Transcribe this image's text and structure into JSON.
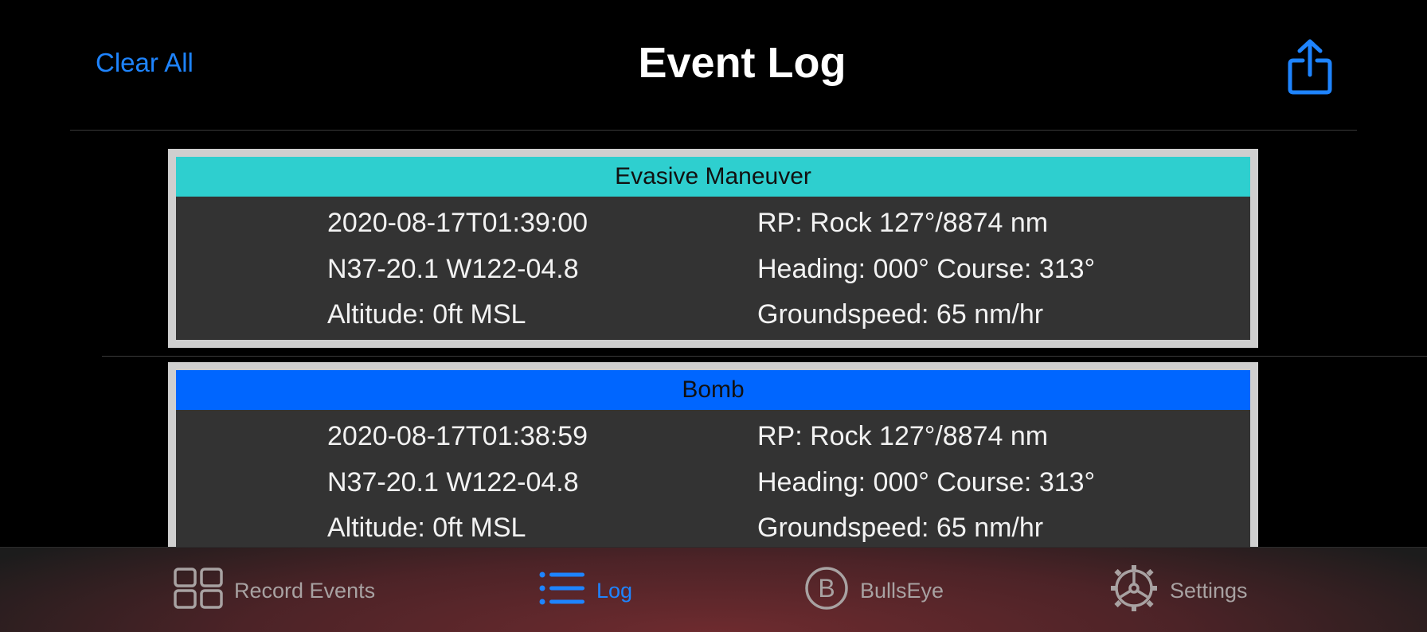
{
  "header": {
    "clear_all_label": "Clear All",
    "title": "Event Log",
    "share_icon": "share-icon"
  },
  "colors": {
    "accent": "#1e84ff",
    "evasive": "#2ecfcf",
    "bomb": "#0066ff"
  },
  "events": [
    {
      "type": "Evasive Maneuver",
      "color": "#2ecfcf",
      "timestamp": "2020-08-17T01:39:00",
      "position": "N37-20.1 W122-04.8",
      "altitude": "Altitude: 0ft MSL",
      "rp": "RP: Rock 127°/8874 nm",
      "heading_course": "Heading: 000° Course: 313°",
      "groundspeed": "Groundspeed: 65 nm/hr"
    },
    {
      "type": "Bomb",
      "color": "#0066ff",
      "timestamp": "2020-08-17T01:38:59",
      "position": "N37-20.1 W122-04.8",
      "altitude": "Altitude: 0ft MSL",
      "rp": "RP: Rock 127°/8874 nm",
      "heading_course": "Heading: 000° Course: 313°",
      "groundspeed": "Groundspeed: 65 nm/hr"
    }
  ],
  "tabs": [
    {
      "label": "Record Events",
      "icon": "grid-icon",
      "active": false
    },
    {
      "label": "Log",
      "icon": "list-icon",
      "active": true
    },
    {
      "label": "BullsEye",
      "icon": "bullseye-icon",
      "active": false
    },
    {
      "label": "Settings",
      "icon": "gear-icon",
      "active": false
    }
  ]
}
